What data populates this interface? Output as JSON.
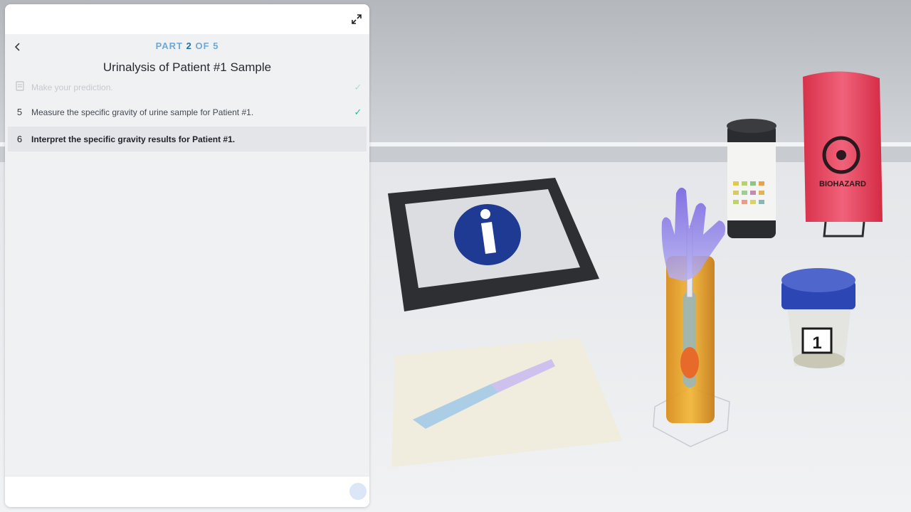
{
  "panel": {
    "part": {
      "prefix": "PART",
      "current": "2",
      "of": "OF",
      "total": "5"
    },
    "title": "Urinalysis of Patient #1 Sample",
    "steps": [
      {
        "number": "",
        "label": "Make your prediction.",
        "completed": true,
        "state": "faded"
      },
      {
        "number": "5",
        "label": "Measure the specific gravity of urine sample for Patient #1.",
        "completed": true,
        "state": "done"
      },
      {
        "number": "6",
        "label": "Interpret the specific gravity results for Patient #1.",
        "completed": false,
        "state": "active"
      }
    ],
    "icons": {
      "expand": "expand-icon",
      "back": "chevron-left-icon",
      "check": "checkmark-icon",
      "prediction": "notebook-icon"
    }
  },
  "scene": {
    "info_tablet_icon": "info-icon",
    "biohazard_label": "BIOHAZARD",
    "specimen_number": "1"
  },
  "colors": {
    "accent": "#1d6fa5",
    "check": "#2fb89a",
    "info_blue": "#1f3a93",
    "biohazard_red": "#e8354f",
    "cup_lid": "#2c46b3"
  }
}
